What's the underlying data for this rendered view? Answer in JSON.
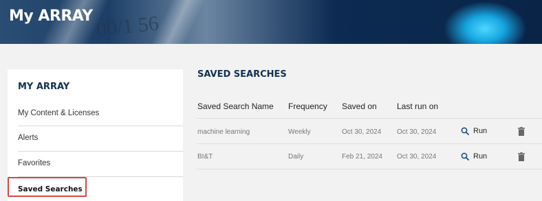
{
  "banner": {
    "title": "My ARRAY",
    "decor_text": "00/1 56"
  },
  "sidebar": {
    "heading": "MY ARRAY",
    "items": [
      {
        "label": "My Content & Licenses"
      },
      {
        "label": "Alerts"
      },
      {
        "label": "Favorites"
      },
      {
        "label": "Saved Searches",
        "active": true
      }
    ]
  },
  "main": {
    "title": "SAVED SEARCHES",
    "columns": [
      "Saved Search Name",
      "Frequency",
      "Saved on",
      "Last run on"
    ],
    "rows": [
      {
        "name": "machine learning",
        "frequency": "Weekly",
        "saved_on": "Oct 30, 2024",
        "last_run_on": "Oct 30, 2024",
        "run_label": "Run"
      },
      {
        "name": "BI&T",
        "frequency": "Daily",
        "saved_on": "Feb 21, 2024",
        "last_run_on": "Oct 30, 2024",
        "run_label": "Run"
      }
    ]
  },
  "colors": {
    "heading": "#14304e",
    "highlight": "#d64545",
    "run_icon": "#1f4f8a",
    "trash_icon": "#666666"
  },
  "icons": {
    "run": "search-icon",
    "delete": "trash-icon"
  }
}
